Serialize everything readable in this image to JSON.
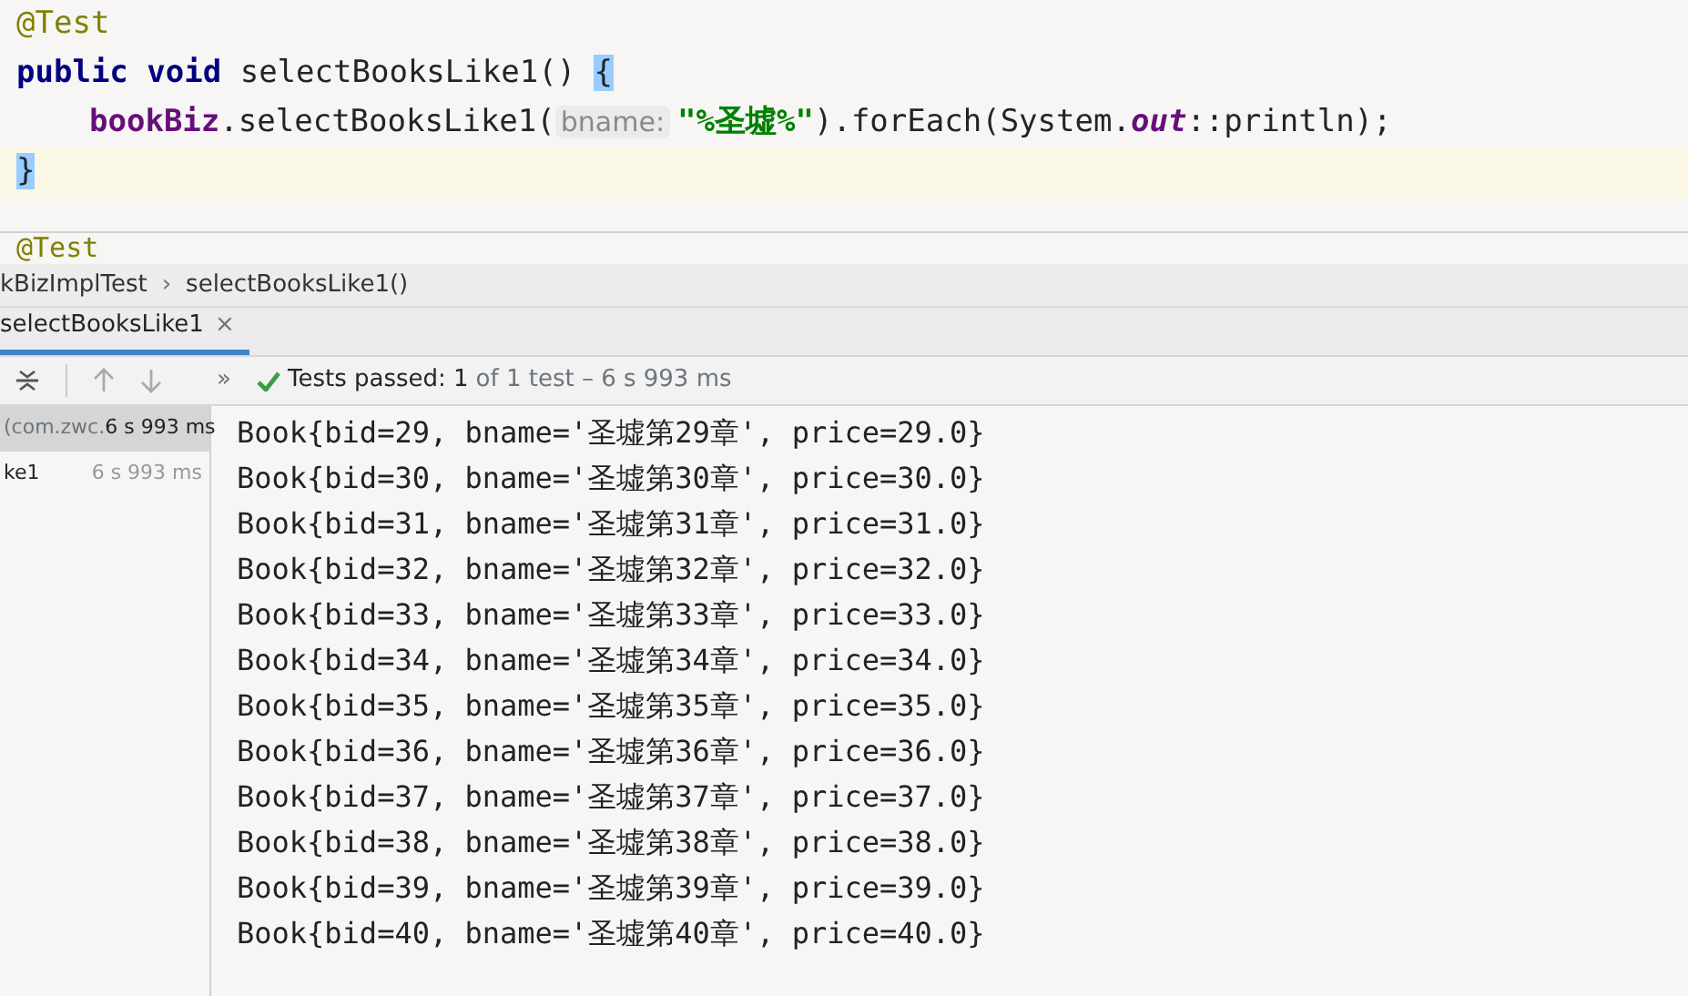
{
  "editor": {
    "lines": [
      {
        "current": false,
        "tokens": [
          {
            "kind": "annotation",
            "text": "@Test"
          }
        ]
      },
      {
        "current": false,
        "tokens": [
          {
            "kind": "keyword",
            "text": "public void "
          },
          {
            "kind": "plain",
            "text": "selectBooksLike1() "
          },
          {
            "kind": "brace",
            "text": "{"
          }
        ]
      },
      {
        "current": false,
        "tokens": [
          {
            "kind": "indent"
          },
          {
            "kind": "field",
            "text": "bookBiz"
          },
          {
            "kind": "plain",
            "text": ".selectBooksLike1("
          },
          {
            "kind": "hint",
            "text": "bname:"
          },
          {
            "kind": "string",
            "text": "\"%圣墟%\""
          },
          {
            "kind": "plain",
            "text": ").forEach(System."
          },
          {
            "kind": "static",
            "text": "out"
          },
          {
            "kind": "plain",
            "text": "::println);"
          }
        ]
      },
      {
        "current": true,
        "tokens": [
          {
            "kind": "brace",
            "text": "}"
          }
        ]
      }
    ],
    "next_line": "@Test"
  },
  "breadcrumbs": [
    "kBizImplTest",
    "selectBooksLike1()"
  ],
  "breadcrumb_separator": "›",
  "run_tabs": [
    {
      "label": "selectBooksLike1",
      "close": "×",
      "selected": true
    }
  ],
  "toolbar": {
    "more": "»",
    "status": {
      "passed": "Tests passed: 1",
      "rest": "of 1 test – 6 s 993 ms"
    }
  },
  "test_tree": [
    {
      "name": "(com.zwc.",
      "time": "6 s 993 ms",
      "selected": true
    },
    {
      "name": "ke1",
      "time": "6 s 993 ms",
      "selected": false
    }
  ],
  "console": [
    "Book{bid=29, bname='圣墟第29章', price=29.0}",
    "Book{bid=30, bname='圣墟第30章', price=30.0}",
    "Book{bid=31, bname='圣墟第31章', price=31.0}",
    "Book{bid=32, bname='圣墟第32章', price=32.0}",
    "Book{bid=33, bname='圣墟第33章', price=33.0}",
    "Book{bid=34, bname='圣墟第34章', price=34.0}",
    "Book{bid=35, bname='圣墟第35章', price=35.0}",
    "Book{bid=36, bname='圣墟第36章', price=36.0}",
    "Book{bid=37, bname='圣墟第37章', price=37.0}",
    "Book{bid=38, bname='圣墟第38章', price=38.0}",
    "Book{bid=39, bname='圣墟第39章', price=39.0}",
    "Book{bid=40, bname='圣墟第40章', price=40.0}"
  ]
}
